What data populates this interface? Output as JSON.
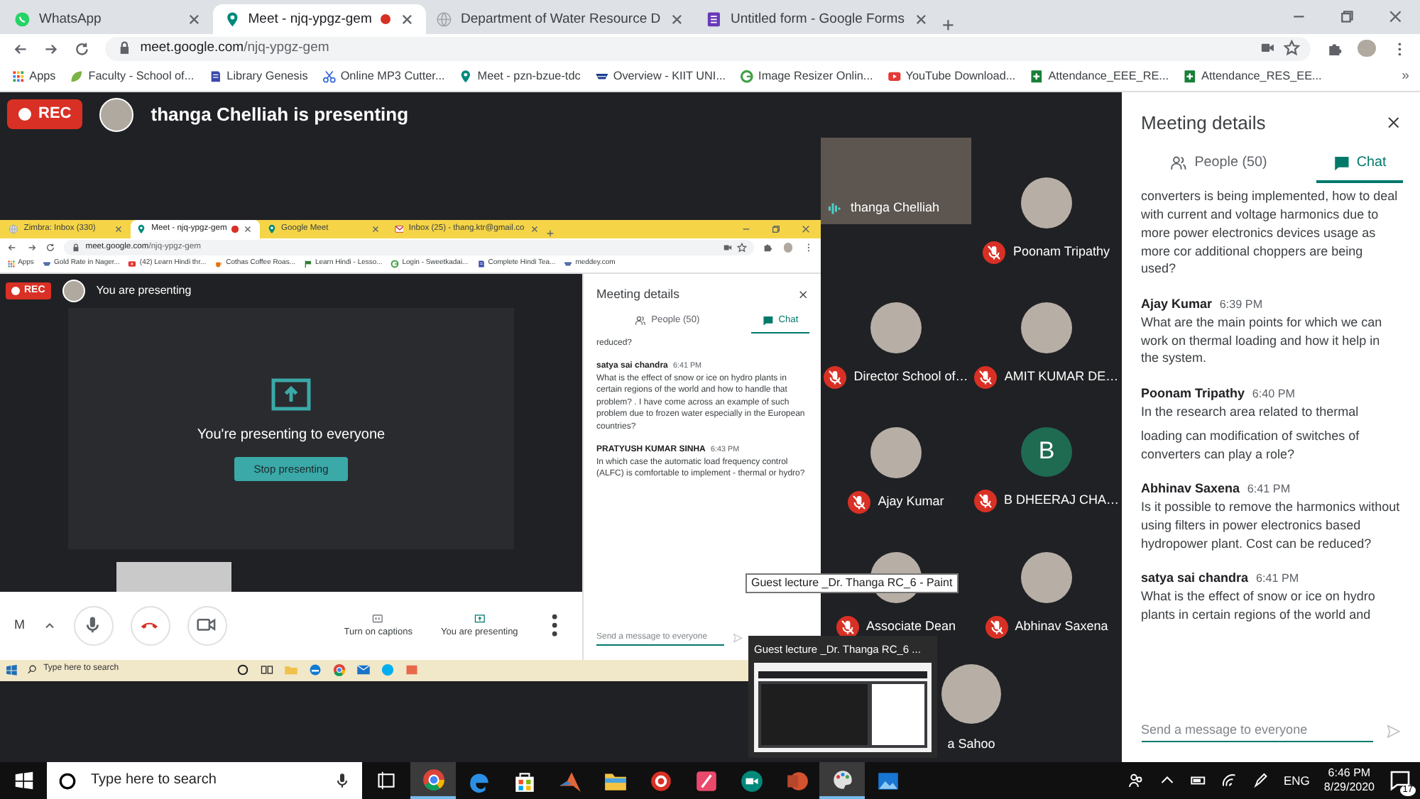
{
  "browser": {
    "tabs": [
      {
        "kind": "chat",
        "title": "WhatsApp",
        "selected": false,
        "recording": false
      },
      {
        "kind": "meet",
        "title": "Meet - njq-ypgz-gem",
        "selected": true,
        "recording": true
      },
      {
        "kind": "site",
        "title": "Department of Water Resource D",
        "selected": false,
        "recording": false
      },
      {
        "kind": "form",
        "title": "Untitled form - Google Forms",
        "selected": false,
        "recording": false
      }
    ],
    "address": {
      "host": "meet.google.com",
      "path": "/njq-ypgz-gem"
    },
    "bookmarks": [
      {
        "kind": "apps",
        "label": "Apps"
      },
      {
        "kind": "leaf",
        "label": "Faculty - School of..."
      },
      {
        "kind": "book",
        "label": "Library Genesis"
      },
      {
        "kind": "scissors",
        "label": "Online MP3 Cutter..."
      },
      {
        "kind": "meet",
        "label": "Meet - pzn-bzue-tdc"
      },
      {
        "kind": "logo",
        "label": "Overview - KIIT UNI..."
      },
      {
        "kind": "circle",
        "label": "Image Resizer Onlin..."
      },
      {
        "kind": "play",
        "label": "YouTube Download..."
      },
      {
        "kind": "sheet",
        "label": "Attendance_EEE_RE..."
      },
      {
        "kind": "sheet",
        "label": "Attendance_RES_EE..."
      }
    ],
    "overflow": "»"
  },
  "meeting": {
    "recording_label": "REC",
    "presenter_status": "thanga Chelliah is presenting",
    "shared_screen": {
      "browser": {
        "tabs": [
          {
            "kind": "site",
            "title": "Zimbra: Inbox (330)",
            "selected": false,
            "recording": false
          },
          {
            "kind": "meet",
            "title": "Meet - njq-ypgz-gem",
            "selected": true,
            "recording": true
          },
          {
            "kind": "meet",
            "title": "Google Meet",
            "selected": false,
            "recording": false
          },
          {
            "kind": "mail",
            "title": "Inbox (25) - thang.ktr@gmail.co",
            "selected": false,
            "recording": false
          }
        ],
        "address": {
          "host": "meet.google.com",
          "path": "/njq-ypgz-gem"
        },
        "bookmarks": [
          {
            "kind": "apps",
            "label": "Apps"
          },
          {
            "kind": "logo",
            "label": "Gold Rate in Nager..."
          },
          {
            "kind": "play",
            "label": "(42) Learn Hindi thr..."
          },
          {
            "kind": "cup",
            "label": "Cothas Coffee Roas..."
          },
          {
            "kind": "flag",
            "label": "Learn Hindi - Lesso..."
          },
          {
            "kind": "circle",
            "label": "Login - Sweetkadai..."
          },
          {
            "kind": "book",
            "label": "Complete Hindi Tea..."
          },
          {
            "kind": "logo",
            "label": "meddey.com"
          }
        ]
      },
      "recording_label": "REC",
      "status": "You are presenting",
      "message": "You're presenting to everyone",
      "stop_button": "Stop presenting",
      "meeting_label": "M",
      "controls": [
        {
          "kind": "captions",
          "label": "Turn on captions"
        },
        {
          "kind": "present",
          "label": "You are presenting"
        }
      ],
      "panel": {
        "title": "Meeting details",
        "tabs": [
          {
            "kind": "people",
            "label": "People (50)",
            "selected": false
          },
          {
            "kind": "chat",
            "label": "Chat",
            "selected": true
          }
        ],
        "messages": [
          {
            "paragraphs": [
              "reduced?"
            ]
          },
          {
            "sender": "satya sai chandra",
            "time": "6:41 PM",
            "paragraphs": [
              "What is the effect of snow or ice on hydro plants in certain regions of the world and how to handle that problem? . I have come across an example of such problem due to frozen water especially in the European countries?"
            ]
          },
          {
            "sender": "PRATYUSH KUMAR SINHA",
            "time": "6:43 PM",
            "paragraphs": [
              "In which case the automatic load frequency control (ALFC) is comfortable to implement - thermal or hydro?"
            ]
          }
        ],
        "input": {
          "placeholder": "Send a message to everyone"
        }
      },
      "taskbar": {
        "search_placeholder": "Type here to search"
      }
    },
    "participants": [
      {
        "kind": "video",
        "name": "thanga Chelliah",
        "muted": false,
        "speaking": true
      },
      {
        "kind": "photo",
        "name": "Poonam Tripathy",
        "muted": true,
        "speaking": false
      },
      {
        "kind": "photo",
        "name": "Director School of…",
        "muted": true,
        "speaking": false
      },
      {
        "kind": "photo",
        "name": "AMIT KUMAR DE…",
        "muted": true,
        "speaking": false
      },
      {
        "kind": "photo",
        "name": "Ajay Kumar",
        "muted": true,
        "speaking": false
      },
      {
        "kind": "initial",
        "initial": "B",
        "name": "B DHEERAJ CHA…",
        "muted": true,
        "speaking": false
      },
      {
        "kind": "photo",
        "name": "Associate Dean",
        "muted": true,
        "speaking": false
      },
      {
        "kind": "photo",
        "name": "Abhinav Saxena",
        "muted": true,
        "speaking": false
      },
      {
        "kind": "photo",
        "name": "a Sahoo",
        "muted": false,
        "speaking": false
      }
    ]
  },
  "details_panel": {
    "title": "Meeting details",
    "tabs": [
      {
        "kind": "people",
        "label": "People (50)",
        "selected": false
      },
      {
        "kind": "chat",
        "label": "Chat",
        "selected": true
      }
    ],
    "messages": [
      {
        "paragraphs": [
          "converters is being implemented, how to deal with current and voltage harmonics due to more power electronics devices usage as more cor additional choppers are being used?"
        ]
      },
      {
        "sender": "Ajay Kumar",
        "time": "6:39 PM",
        "paragraphs": [
          "What are the main points for which we can work on thermal loading and how it help in the system."
        ]
      },
      {
        "sender": "Poonam Tripathy",
        "time": "6:40 PM",
        "paragraphs": [
          "In the research area related to thermal",
          "loading can modification of switches of converters can play a role?"
        ]
      },
      {
        "sender": "Abhinav Saxena",
        "time": "6:41 PM",
        "paragraphs": [
          "Is it possible to remove the harmonics without using filters in power electronics based hydropower plant. Cost can be reduced?"
        ]
      },
      {
        "sender": "satya sai chandra",
        "time": "6:41 PM",
        "paragraphs": [
          "What is the effect of snow or ice on hydro plants in certain regions of the world and"
        ]
      }
    ],
    "input": {
      "placeholder": "Send a message to everyone"
    }
  },
  "taskbar_preview": {
    "tooltip": "Guest lecture _Dr. Thanga RC_6 - Paint",
    "title": "Guest lecture _Dr. Thanga RC_6 ..."
  },
  "taskbar": {
    "search_placeholder": "Type here to search",
    "apps": [
      {
        "kind": "chrome",
        "selected": true
      },
      {
        "kind": "edge",
        "selected": false
      },
      {
        "kind": "store",
        "selected": false
      },
      {
        "kind": "matlab",
        "selected": false
      },
      {
        "kind": "folder",
        "selected": false
      },
      {
        "kind": "ring",
        "selected": false
      },
      {
        "kind": "quill",
        "selected": false
      },
      {
        "kind": "meet",
        "selected": false
      },
      {
        "kind": "slides",
        "selected": false
      },
      {
        "kind": "paint",
        "selected": true
      },
      {
        "kind": "photos",
        "selected": false
      }
    ],
    "language": "ENG",
    "time": "6:46 PM",
    "date": "8/29/2020",
    "notifications": "17"
  }
}
